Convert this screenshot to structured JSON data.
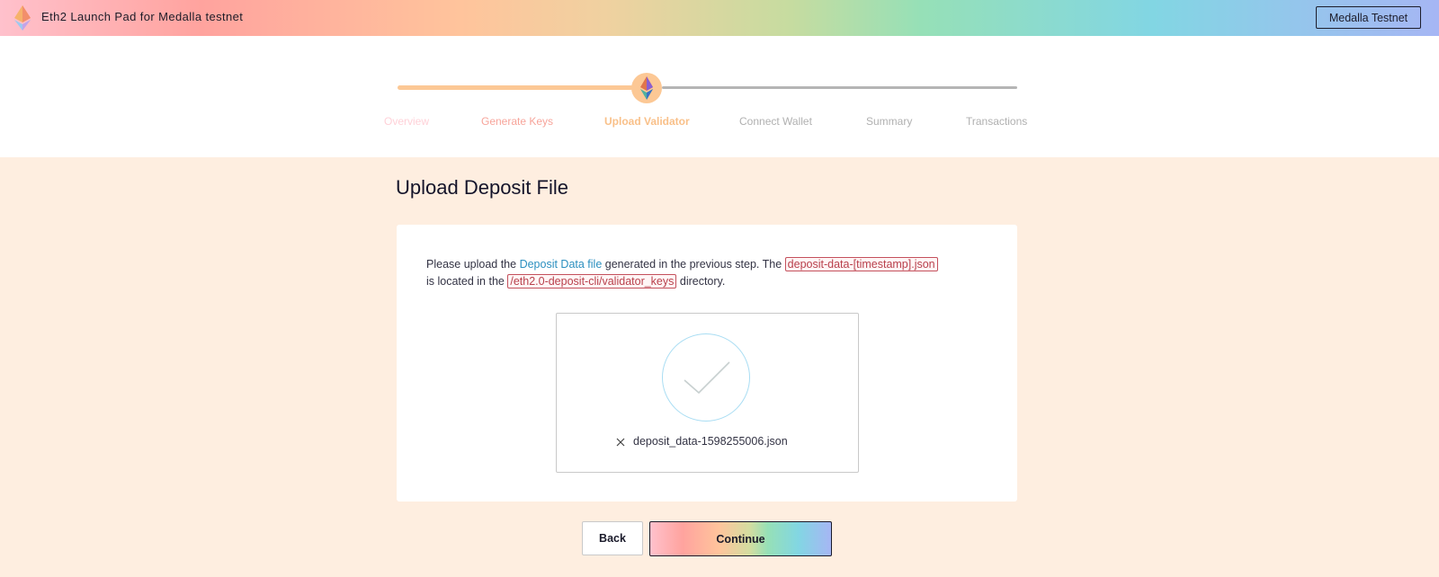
{
  "header": {
    "app_title": "Eth2 Launch Pad for Medalla testnet",
    "network_button": "Medalla Testnet",
    "logo_icon": "ethereum-logo-icon"
  },
  "progress": {
    "steps": [
      {
        "label": "Overview",
        "state": "complete"
      },
      {
        "label": "Generate Keys",
        "state": "complete"
      },
      {
        "label": "Upload Validator",
        "state": "active"
      },
      {
        "label": "Connect Wallet",
        "state": "pending"
      },
      {
        "label": "Summary",
        "state": "pending"
      },
      {
        "label": "Transactions",
        "state": "pending"
      }
    ],
    "current_step_icon": "ethereum-diamond-icon"
  },
  "main": {
    "title": "Upload Deposit File",
    "intro": {
      "part1": "Please upload the ",
      "link_text": "Deposit Data file",
      "part2": " generated in the previous step. The ",
      "code_file": "deposit-data-[timestamp].json",
      "part3": " is located in the ",
      "code_dir": "/eth2.0-deposit-cli/validator_keys",
      "part4": " directory."
    },
    "upload": {
      "status_icon": "checkmark-icon",
      "remove_icon": "close-icon",
      "file_name": "deposit_data-1598255006.json"
    },
    "buttons": {
      "back": "Back",
      "continue": "Continue"
    }
  },
  "colors": {
    "accent_orange": "#fcc895",
    "link_blue": "#2b8fbf",
    "code_red": "#b8404c",
    "page_bg": "#feeee0"
  }
}
